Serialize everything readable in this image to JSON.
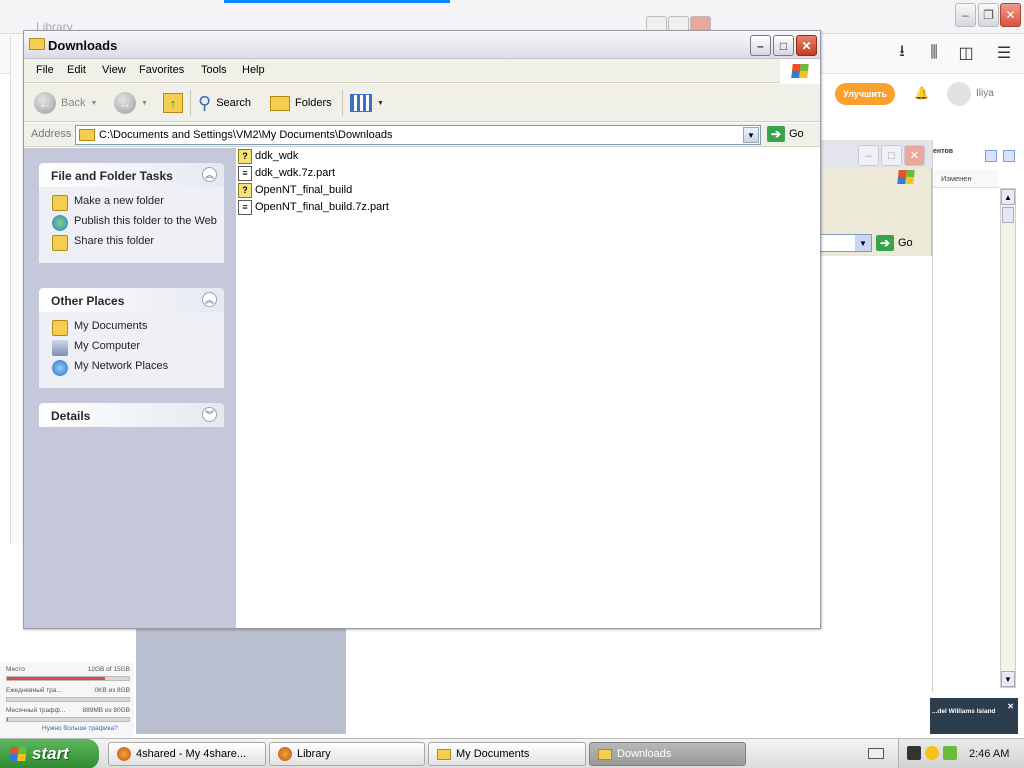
{
  "background_browser": {
    "library_window_title": "Library",
    "upgrade_label": "Улучшить",
    "user_name": "Iliya",
    "right_pane": {
      "header_fragment": "ентов",
      "column_modified": "Изменен"
    },
    "second_window": {
      "go_label": "Go"
    },
    "storage": {
      "space_label": "Место",
      "space_value": "12GB of 15GB",
      "space_fraction": 0.8,
      "daily_label": "Ежедневный тра...",
      "daily_value": "0KB из 8GB",
      "daily_fraction": 0.0,
      "monthly_label": "Месячный трафф...",
      "monthly_value": "889MB из 80GB",
      "monthly_fraction": 0.01,
      "more_traffic_link": "Нужно больше трафика?"
    },
    "promo_text": "...del Williams Island"
  },
  "window": {
    "title": "Downloads",
    "menu": [
      "File",
      "Edit",
      "View",
      "Favorites",
      "Tools",
      "Help"
    ],
    "toolbar": {
      "back_label": "Back",
      "search_label": "Search",
      "folders_label": "Folders"
    },
    "address": {
      "label": "Address",
      "path": "C:\\Documents and Settings\\VM2\\My Documents\\Downloads",
      "go_label": "Go"
    },
    "tasks": {
      "file_folder": {
        "title": "File and Folder Tasks",
        "items": [
          "Make a new folder",
          "Publish this folder to the Web",
          "Share this folder"
        ]
      },
      "other_places": {
        "title": "Other Places",
        "items": [
          "My Documents",
          "My Computer",
          "My Network Places"
        ]
      },
      "details": {
        "title": "Details"
      }
    },
    "files": [
      {
        "name": "ddk_wdk",
        "icon": "unknown-file-icon"
      },
      {
        "name": "ddk_wdk.7z.part",
        "icon": "part-file-icon"
      },
      {
        "name": "OpenNT_final_build",
        "icon": "unknown-file-icon"
      },
      {
        "name": "OpenNT_final_build.7z.part",
        "icon": "part-file-icon"
      }
    ]
  },
  "taskbar": {
    "start_label": "start",
    "buttons": [
      {
        "label": "4shared - My 4share...",
        "active": false
      },
      {
        "label": "Library",
        "active": false
      },
      {
        "label": "My Documents",
        "active": false
      },
      {
        "label": "Downloads",
        "active": true
      }
    ],
    "clock": "2:46 AM"
  },
  "colors": {
    "taskpane_bg": "#c5c8da",
    "start_green": "#3a9a3a",
    "upgrade_orange": "#f9a12a",
    "go_green": "#37a34a"
  }
}
